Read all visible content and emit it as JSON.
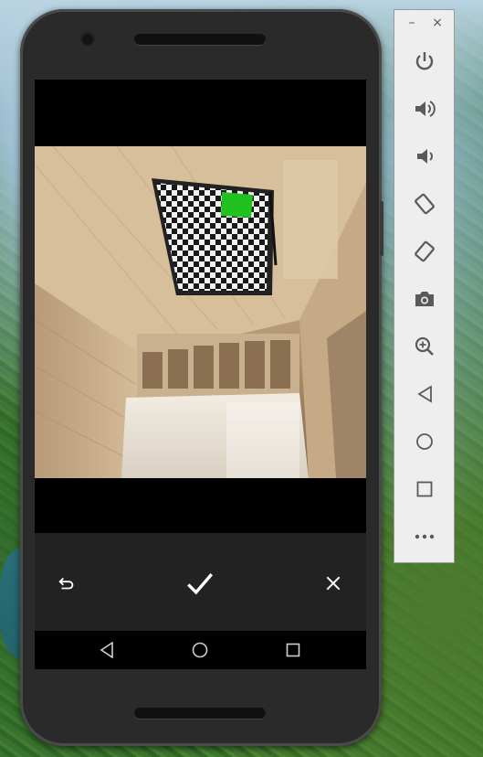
{
  "desktop": {
    "background": "aerial-rainforest-wallpaper"
  },
  "emulator_window": {
    "controls": {
      "minimize_label": "–",
      "close_label": "×"
    },
    "toolbar": [
      {
        "name": "power-icon",
        "action": "power"
      },
      {
        "name": "volume-up-icon",
        "action": "volume-up"
      },
      {
        "name": "volume-down-icon",
        "action": "volume-down"
      },
      {
        "name": "rotate-left-icon",
        "action": "rotate-left"
      },
      {
        "name": "rotate-right-icon",
        "action": "rotate-right"
      },
      {
        "name": "camera-icon",
        "action": "screenshot"
      },
      {
        "name": "zoom-icon",
        "action": "zoom"
      },
      {
        "name": "back-triangle-icon",
        "action": "back"
      },
      {
        "name": "home-circle-icon",
        "action": "home"
      },
      {
        "name": "overview-square-icon",
        "action": "overview"
      },
      {
        "name": "more-icon",
        "action": "more"
      }
    ]
  },
  "camera_review": {
    "preview": {
      "scene": "ceiling-mounted-checkerboard-target",
      "marker_color": "#1fc21f"
    },
    "controls": [
      {
        "name": "retake-icon",
        "action": "retake"
      },
      {
        "name": "confirm-check-icon",
        "action": "confirm"
      },
      {
        "name": "cancel-close-icon",
        "action": "cancel"
      }
    ]
  },
  "android_navbar": [
    {
      "name": "nav-back-icon",
      "action": "back"
    },
    {
      "name": "nav-home-icon",
      "action": "home"
    },
    {
      "name": "nav-recents-icon",
      "action": "recents"
    }
  ],
  "colors": {
    "phone_body": "#2a2a2a",
    "screen_letterbox": "#000000",
    "toolbar_bg": "#eeeeee",
    "toolbar_icon": "#5a5a5a",
    "control_icon": "#ffffff"
  }
}
